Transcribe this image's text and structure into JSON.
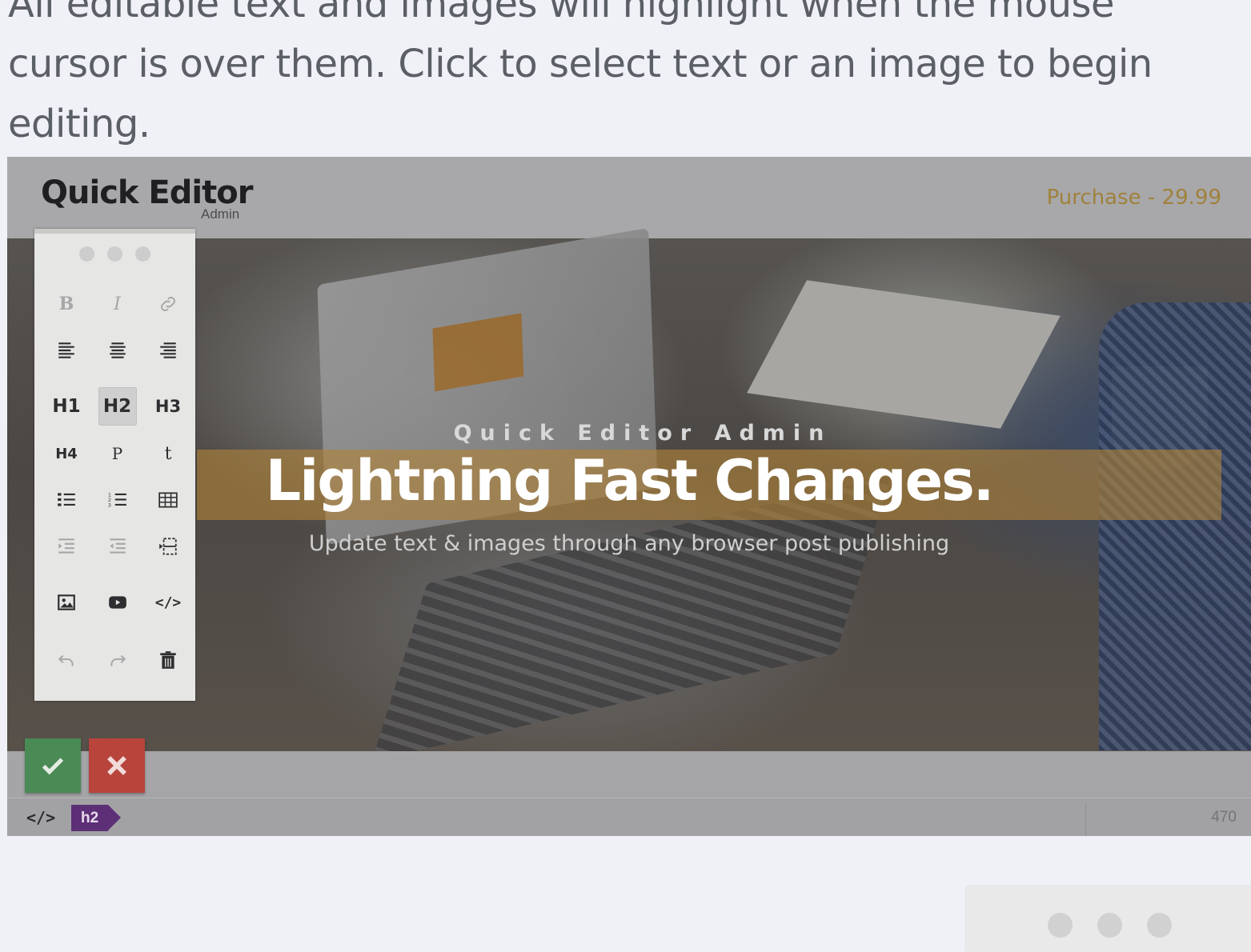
{
  "intro": {
    "text": "All editable text and images will highlight when the mouse cursor is over them. Click to select text or an image to begin editing."
  },
  "app": {
    "title": "Quick Editor",
    "subtitle": "Admin",
    "purchase_label": "Purchase - 29.99"
  },
  "hero": {
    "eyebrow": "Quick Editor Admin",
    "headline": "Lightning Fast Changes.",
    "subline": "Update text & images through any browser post publishing"
  },
  "toolbar": {
    "bold": "B",
    "italic": "I",
    "h1": "H1",
    "h2": "H2",
    "h3": "H3",
    "h4": "H4",
    "p": "P",
    "t": "t",
    "code": "</>"
  },
  "statusbar": {
    "code_label": "</>",
    "tag": "h2",
    "count": "470"
  },
  "colors": {
    "accent_band": "#b08238",
    "ok": "#4a8a55",
    "cancel": "#b8443c",
    "tag": "#5d2f77"
  }
}
